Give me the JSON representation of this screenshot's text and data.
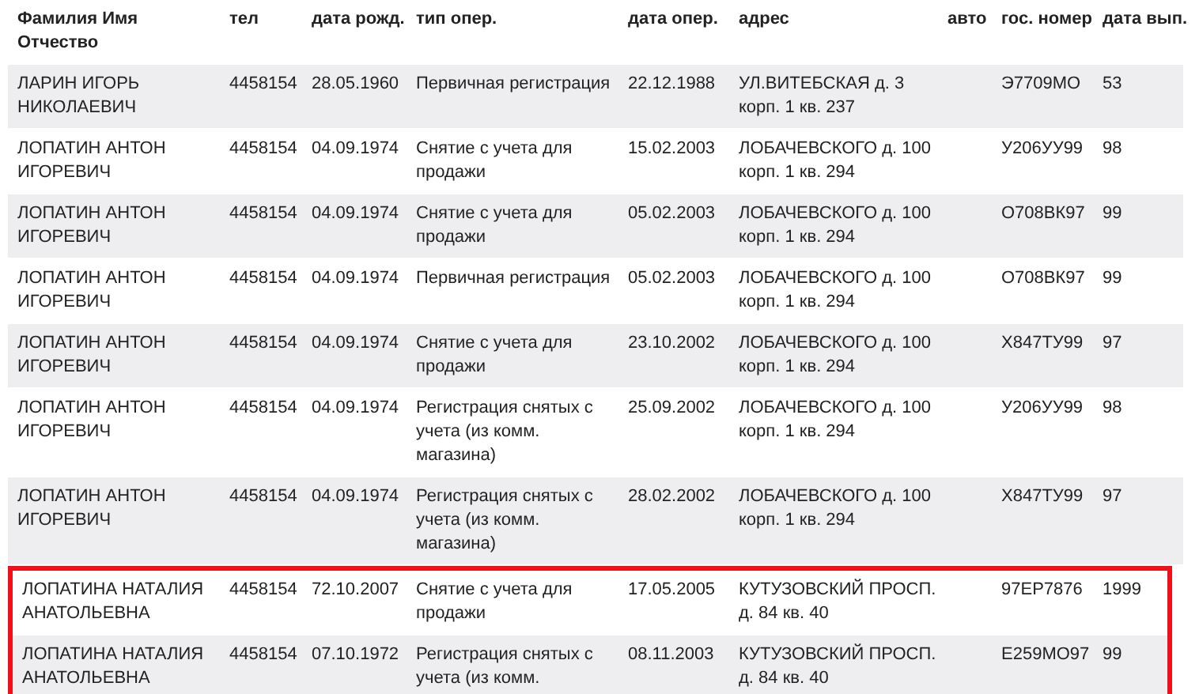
{
  "table": {
    "columns": [
      "Фамилия Имя Отчество",
      "тел",
      "дата рожд.",
      "тип опер.",
      "дата опер.",
      "адрес",
      "авто",
      "гос. номер",
      "дата вып."
    ],
    "rows": [
      {
        "cells": [
          "ЛАРИН ИГОРЬ НИКОЛАЕВИЧ",
          "4458154",
          "28.05.1960",
          "Первичная регистрация",
          "22.12.1988",
          "УЛ.ВИТЕБСКАЯ д. 3 корп. 1 кв. 237",
          "",
          "Э7709МО",
          "53"
        ],
        "highlighted": false
      },
      {
        "cells": [
          "ЛОПАТИН АНТОН ИГОРЕВИЧ",
          "4458154",
          "04.09.1974",
          "Снятие с учета для продажи",
          "15.02.2003",
          "ЛОБАЧЕВСКОГО д. 100 корп. 1 кв. 294",
          "",
          "У206УУ99",
          "98"
        ],
        "highlighted": false
      },
      {
        "cells": [
          "ЛОПАТИН АНТОН ИГОРЕВИЧ",
          "4458154",
          "04.09.1974",
          "Снятие с учета для продажи",
          "05.02.2003",
          "ЛОБАЧЕВСКОГО д. 100 корп. 1 кв. 294",
          "",
          "О708ВК97",
          "99"
        ],
        "highlighted": false
      },
      {
        "cells": [
          "ЛОПАТИН АНТОН ИГОРЕВИЧ",
          "4458154",
          "04.09.1974",
          "Первичная регистрация",
          "05.02.2003",
          "ЛОБАЧЕВСКОГО д. 100 корп. 1 кв. 294",
          "",
          "О708ВК97",
          "99"
        ],
        "highlighted": false
      },
      {
        "cells": [
          "ЛОПАТИН АНТОН ИГОРЕВИЧ",
          "4458154",
          "04.09.1974",
          "Снятие с учета для продажи",
          "23.10.2002",
          "ЛОБАЧЕВСКОГО д. 100 корп. 1 кв. 294",
          "",
          "Х847ТУ99",
          "97"
        ],
        "highlighted": false
      },
      {
        "cells": [
          "ЛОПАТИН АНТОН ИГОРЕВИЧ",
          "4458154",
          "04.09.1974",
          "Регистрация снятых с учета (из комм. магазина)",
          "25.09.2002",
          "ЛОБАЧЕВСКОГО д. 100 корп. 1 кв. 294",
          "",
          "У206УУ99",
          "98"
        ],
        "highlighted": false
      },
      {
        "cells": [
          "ЛОПАТИН АНТОН ИГОРЕВИЧ",
          "4458154",
          "04.09.1974",
          "Регистрация снятых с учета (из комм. магазина)",
          "28.02.2002",
          "ЛОБАЧЕВСКОГО д. 100 корп. 1 кв. 294",
          "",
          "Х847ТУ99",
          "97"
        ],
        "highlighted": false
      },
      {
        "cells": [
          "ЛОПАТИНА НАТАЛИЯ АНАТОЛЬЕВНА",
          "4458154",
          "72.10.2007",
          "Снятие с учета для продажи",
          "17.05.2005",
          "КУТУЗОВСКИЙ ПРОСП. д. 84 кв. 40",
          "",
          "97ЕР7876",
          "1999"
        ],
        "highlighted": true
      },
      {
        "cells": [
          "ЛОПАТИНА НАТАЛИЯ АНАТОЛЬЕВНА",
          "4458154",
          "07.10.1972",
          "Регистрация снятых с учета (из комм.",
          "08.11.2003",
          "КУТУЗОВСКИЙ ПРОСП. д. 84 кв. 40",
          "",
          "Е259МО97",
          "99"
        ],
        "highlighted": true
      }
    ]
  }
}
